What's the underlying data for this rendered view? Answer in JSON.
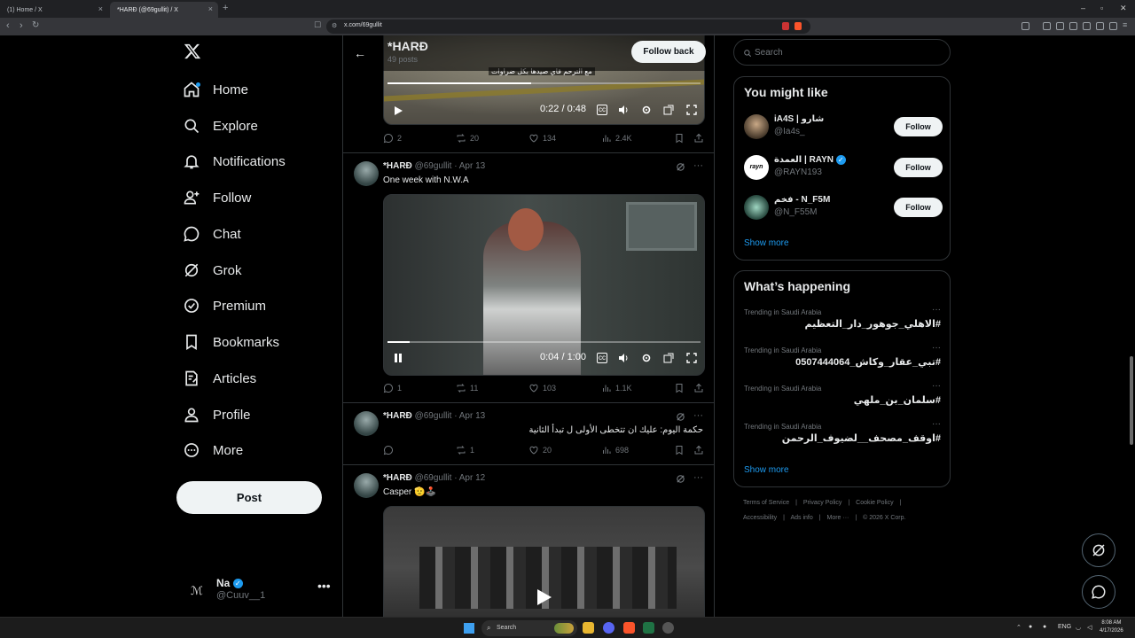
{
  "browser": {
    "tabs": [
      {
        "title": "(1) Home / X",
        "active": false
      },
      {
        "title": "*HARĐ (@69gullit) / X",
        "active": true
      }
    ],
    "new_tab": "+",
    "url": "x.com/69gullit",
    "window_controls": [
      "–",
      "▫",
      "✕"
    ]
  },
  "sidebar": {
    "items": [
      {
        "label": "Home",
        "icon": "home-icon"
      },
      {
        "label": "Explore",
        "icon": "search-icon"
      },
      {
        "label": "Notifications",
        "icon": "bell-icon"
      },
      {
        "label": "Follow",
        "icon": "follow-icon"
      },
      {
        "label": "Chat",
        "icon": "chat-icon"
      },
      {
        "label": "Grok",
        "icon": "grok-icon"
      },
      {
        "label": "Premium",
        "icon": "premium-icon"
      },
      {
        "label": "Bookmarks",
        "icon": "bookmark-icon"
      },
      {
        "label": "Articles",
        "icon": "articles-icon"
      },
      {
        "label": "Profile",
        "icon": "profile-icon"
      },
      {
        "label": "More",
        "icon": "more-circle-icon"
      }
    ],
    "post_button": "Post",
    "account": {
      "name": "Na",
      "handle": "@Cuuv__1",
      "more": "•••"
    }
  },
  "profile_header": {
    "back": "←",
    "name": "*HARĐ",
    "posts": "49 posts",
    "follow_back": "Follow back"
  },
  "posts": [
    {
      "video_caption": "مع الترحم قاي صيدها بكل ضراوات",
      "video_time": "0:22 / 0:48",
      "video_progress": 0.46,
      "stats": {
        "replies": "2",
        "reposts": "20",
        "likes": "134",
        "views": "2.4K"
      }
    },
    {
      "name": "*HARĐ",
      "handle": "@69gullit",
      "date": "· Apr 13",
      "text": "One week with N.W.A",
      "video_time": "0:04 / 1:00",
      "video_progress": 0.07,
      "stats": {
        "replies": "1",
        "reposts": "11",
        "likes": "103",
        "views": "1.1K"
      }
    },
    {
      "name": "*HARĐ",
      "handle": "@69gullit",
      "date": "· Apr 13",
      "text": "حكمة اليوم: عليك ان تتخطى الأولى ل تبدأ الثانية",
      "stats": {
        "replies": "",
        "reposts": "1",
        "likes": "20",
        "views": "698"
      }
    },
    {
      "name": "*HARĐ",
      "handle": "@69gullit",
      "date": "· Apr 12",
      "text": "Casper 🫡🕹️"
    }
  ],
  "right": {
    "search_placeholder": "Search",
    "you_might_like": {
      "title": "You might like",
      "users": [
        {
          "name": "iA4S | شارو",
          "handle": "@Ia4s_",
          "button": "Follow",
          "verified": false
        },
        {
          "name": "العمدة | RAYN",
          "handle": "@RAYN193",
          "button": "Follow",
          "verified": true
        },
        {
          "name": "فخم - N_F5M",
          "handle": "@N_F55M",
          "button": "Follow",
          "verified": false
        }
      ],
      "show_more": "Show more"
    },
    "whats_happening": {
      "title": "What’s happening",
      "trends": [
        {
          "context": "Trending in Saudi Arabia",
          "tag": "#الاهلي_جوهور_دار_التعظيم"
        },
        {
          "context": "Trending in Saudi Arabia",
          "tag": "#تبي_عقار_وكاش_0507444064"
        },
        {
          "context": "Trending in Saudi Arabia",
          "tag": "#سلمان_بن_ملهي"
        },
        {
          "context": "Trending in Saudi Arabia",
          "tag": "#اوقف_مصحف__لضيوف_الرحمن"
        }
      ],
      "show_more": "Show more"
    },
    "footer": {
      "line1": [
        "Terms of Service",
        "Privacy Policy",
        "Cookie Policy"
      ],
      "line2": [
        "Accessibility",
        "Ads info",
        "More ···",
        "© 2026 X Corp."
      ]
    }
  },
  "taskbar": {
    "search": "Search",
    "lang": "ENG",
    "time": "8:08 AM",
    "date": "4/17/2026"
  },
  "colors": {
    "accent": "#1d9bf0",
    "bg": "#000000",
    "border": "#2f3336",
    "muted": "#71767b"
  }
}
